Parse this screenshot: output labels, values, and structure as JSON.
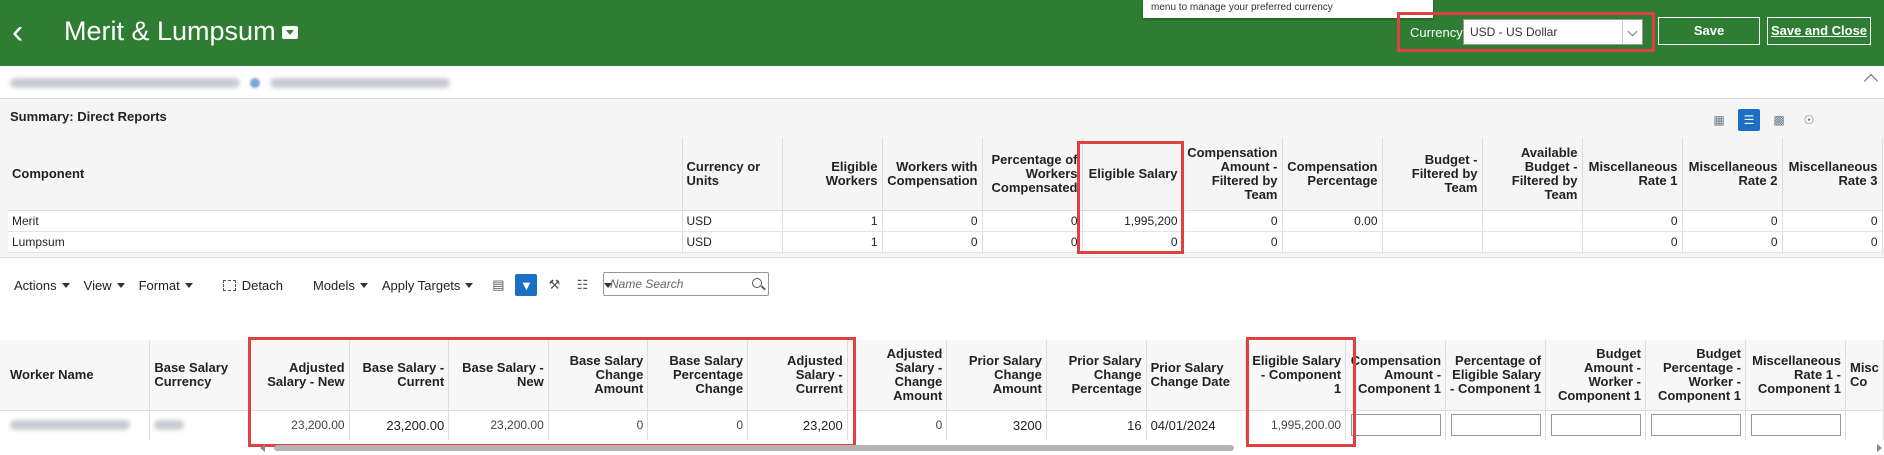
{
  "header": {
    "title": "Merit & Lumpsum",
    "tooltip": "menu to manage your preferred currency",
    "currency_label": "Currency",
    "currency_value": "USD - US Dollar",
    "save_label": "Save",
    "save_close_label": "Save and Close"
  },
  "summary": {
    "title": "Summary: Direct Reports",
    "columns": [
      "Component",
      "Currency or Units",
      "Eligible Workers",
      "Workers with Compensation",
      "Percentage of Workers Compensated",
      "Eligible Salary",
      "Compensation Amount - Filtered by Team",
      "Compensation Percentage",
      "Budget - Filtered by Team",
      "Available Budget - Filtered by Team",
      "Miscellaneous Rate 1",
      "Miscellaneous Rate 2",
      "Miscellaneous Rate 3"
    ],
    "rows": [
      [
        "Merit",
        "USD",
        "1",
        "0",
        "0",
        "1,995,200",
        "0",
        "0.00",
        "",
        "",
        "0",
        "0",
        "0"
      ],
      [
        "Lumpsum",
        "USD",
        "1",
        "0",
        "0",
        "0",
        "0",
        "",
        "",
        "",
        "0",
        "0",
        "0"
      ]
    ]
  },
  "toolbar": {
    "actions": "Actions",
    "view": "View",
    "format": "Format",
    "detach": "Detach",
    "models": "Models",
    "apply_targets": "Apply Targets",
    "search_placeholder": "Name Search"
  },
  "workers": {
    "columns": [
      "Worker Name",
      "Base Salary Currency",
      "Adjusted Salary - New",
      "Base Salary - Current",
      "Base Salary - New",
      "Base Salary Change Amount",
      "Base Salary Percentage Change",
      "Adjusted Salary - Current",
      "Adjusted Salary - Change Amount",
      "Prior Salary Change Amount",
      "Prior Salary Change Percentage",
      "Prior Salary Change Date",
      "Eligible Salary - Component 1",
      "Compensation Amount - Component 1",
      "Percentage of Eligible Salary - Component 1",
      "Budget Amount - Worker - Component 1",
      "Budget Percentage - Worker - Component 1",
      "Miscellaneous Rate 1 - Component 1",
      "Misc Co"
    ],
    "row": [
      "",
      "",
      "23,200.00",
      "23,200.00",
      "23,200.00",
      "0",
      "0",
      "23,200",
      "0",
      "3200",
      "16",
      "04/01/2024",
      "1,995,200.00",
      "",
      "",
      "",
      "",
      "",
      ""
    ]
  },
  "icons": {
    "back": "back-chevron-icon",
    "grid_view": "grid-view-icon",
    "table_view": "table-view-icon",
    "chart_view": "chart-view-icon",
    "org_view": "org-view-icon"
  },
  "colors": {
    "header_bg": "#2f7d32",
    "highlight": "#e04040",
    "accent": "#1b6fc4"
  }
}
